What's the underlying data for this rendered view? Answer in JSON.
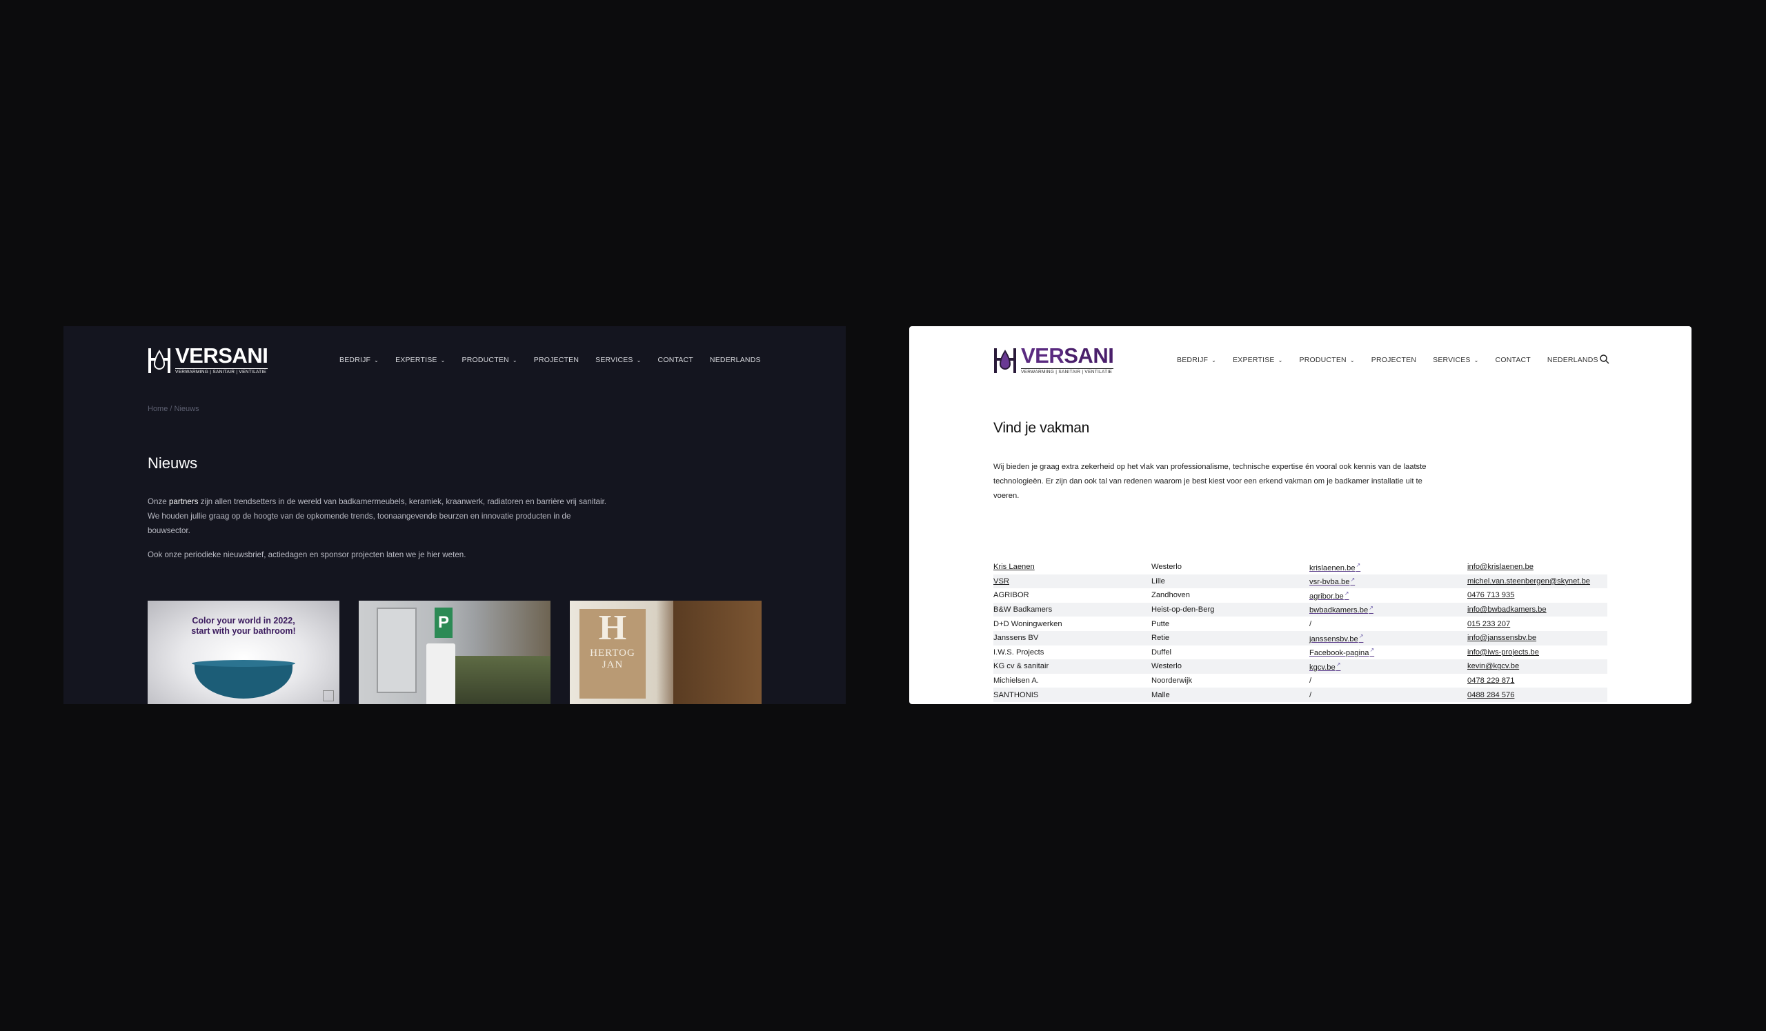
{
  "brand": {
    "name_prefix": "VER",
    "name_suffix": "SANI",
    "tagline": "VERWARMING | SANITAIR | VENTILATIE"
  },
  "nav": {
    "items": [
      {
        "label": "BEDRIJF",
        "dropdown": true
      },
      {
        "label": "EXPERTISE",
        "dropdown": true
      },
      {
        "label": "PRODUCTEN",
        "dropdown": true
      },
      {
        "label": "PROJECTEN",
        "dropdown": false
      },
      {
        "label": "SERVICES",
        "dropdown": true
      },
      {
        "label": "CONTACT",
        "dropdown": false
      },
      {
        "label": "NEDERLANDS",
        "dropdown": true
      }
    ],
    "chevron": "⌄",
    "search_icon": "search-icon"
  },
  "news_page": {
    "breadcrumb": "Home / Nieuws",
    "title": "Nieuws",
    "intro_before": "Onze ",
    "intro_link": "partners",
    "intro_after": " zijn allen trendsetters in de wereld van badkamermeubels, keramiek, kraanwerk, radiatoren en barrière vrij sanitair. We houden jullie graag op de hoogte van de opkomende trends, toonaangevende beurzen en innovatie producten in de bouwsector.",
    "intro_2": "Ook onze periodieke nieuwsbrief, actiedagen en sponsor projecten laten we je hier weten.",
    "cards": [
      {
        "line1": "Color your world in 2022,",
        "line2": "start with your bathroom!"
      },
      {
        "sign": "P"
      },
      {
        "sign": "H",
        "name_line1": "HERTOG",
        "name_line2": "JAN"
      }
    ]
  },
  "vakman_page": {
    "title": "Vind je vakman",
    "intro": "Wij bieden je graag extra zekerheid op het vlak van professionalisme, technische expertise én vooral ook kennis van de laatste technologieën. Er zijn dan ook tal van redenen waarom je best kiest voor een erkend vakman om je badkamer installatie uit te voeren.",
    "rows": [
      {
        "name": "Kris Laenen",
        "place": "Westerlo",
        "site": "krislaenen.be",
        "contact": "info@krislaenen.be",
        "name_link": true
      },
      {
        "name": "VSR",
        "place": "Lille",
        "site": "vsr-bvba.be",
        "contact": "michel.van.steenbergen@skynet.be",
        "name_link": true
      },
      {
        "name": "AGRIBOR",
        "place": "Zandhoven",
        "site": "agribor.be",
        "contact": "0476 713 935",
        "name_link": false
      },
      {
        "name": "B&W Badkamers",
        "place": "Heist-op-den-Berg",
        "site": "bwbadkamers.be",
        "contact": "info@bwbadkamers.be",
        "name_link": false
      },
      {
        "name": "D+D Woningwerken",
        "place": "Putte",
        "site": "/",
        "contact": "015 233 207",
        "name_link": false
      },
      {
        "name": "Janssens BV",
        "place": "Retie",
        "site": "janssensbv.be",
        "contact": "info@janssensbv.be",
        "name_link": false
      },
      {
        "name": "I.W.S. Projects",
        "place": "Duffel",
        "site": "Facebook-pagina",
        "contact": "info@iws-projects.be",
        "name_link": false
      },
      {
        "name": "KG cv & sanitair",
        "place": "Westerlo",
        "site": "kgcv.be",
        "contact": "kevin@kgcv.be",
        "name_link": false
      },
      {
        "name": "Michielsen A.",
        "place": "Noorderwijk",
        "site": "/",
        "contact": "0478 229 871",
        "name_link": false
      },
      {
        "name": "SANTHONIS",
        "place": "Malle",
        "site": "/",
        "contact": "0488 284 576",
        "name_link": false
      }
    ],
    "external_icon": "↗"
  }
}
